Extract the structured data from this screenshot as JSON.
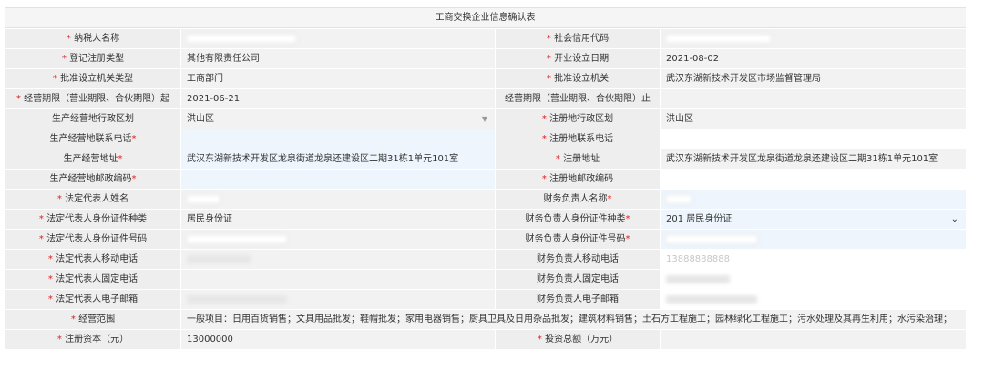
{
  "form_title": "工商交换企业信息确认表",
  "rows": [
    {
      "l1": "纳税人名称",
      "l1_req": "* ",
      "v1": "",
      "l2": "社会信用代码",
      "l2_req": "* ",
      "v2": ""
    },
    {
      "l1": "登记注册类型",
      "l1_req": "* ",
      "v1": "其他有限责任公司",
      "l2": "开业设立日期",
      "l2_req": "* ",
      "v2": "2021-08-02"
    },
    {
      "l1": "批准设立机关类型",
      "l1_req": "* ",
      "v1": "工商部门",
      "l2": "批准设立机关",
      "l2_req": "* ",
      "v2": "武汉东湖新技术开发区市场监督管理局"
    },
    {
      "l1": "经营期限（营业期限、合伙期限）起",
      "l1_req": "* ",
      "v1": "2021-06-21",
      "l2": "经营期限（营业期限、合伙期限）止",
      "l2_req": "",
      "v2": ""
    },
    {
      "l1": "生产经营地行政区划",
      "l1_req": "",
      "v1": "洪山区",
      "l2": "注册地行政区划",
      "l2_req": "* ",
      "v2": "洪山区"
    },
    {
      "l1": "生产经营地联系电话",
      "l1_suf": "*",
      "v1": "",
      "l2": "注册地联系电话",
      "l2_req": "* ",
      "v2": ""
    },
    {
      "l1": "生产经营地址",
      "l1_suf": "*",
      "v1": "武汉东湖新技术开发区龙泉街道龙泉还建设区二期31栋1单元101室",
      "l2": "注册地址",
      "l2_req": "* ",
      "v2": "武汉东湖新技术开发区龙泉街道龙泉还建设区二期31栋1单元101室"
    },
    {
      "l1": "生产经营地邮政编码",
      "l1_suf": "*",
      "v1": "",
      "l2": "注册地邮政编码",
      "l2_req": "* ",
      "v2": ""
    },
    {
      "l1": "法定代表人姓名",
      "l1_req": "* ",
      "v1": "",
      "l2": "财务负责人名称",
      "l2_suf": "*",
      "v2": ""
    },
    {
      "l1": "法定代表人身份证件种类",
      "l1_req": "* ",
      "v1": "居民身份证",
      "l2": "财务负责人身份证件种类",
      "l2_suf": "*",
      "v2": "201 居民身份证"
    },
    {
      "l1": "法定代表人身份证件号码",
      "l1_req": "* ",
      "v1": "",
      "l2": "财务负责人身份证件号码",
      "l2_suf": "*",
      "v2": ""
    },
    {
      "l1": "法定代表人移动电话",
      "l1_req": "* ",
      "v1": "",
      "l2": "财务负责人移动电话",
      "l2_req": "",
      "v2": "13888888888"
    },
    {
      "l1": "法定代表人固定电话",
      "l1_req": "* ",
      "v1": "",
      "l2": "财务负责人固定电话",
      "l2_req": "",
      "v2": ""
    },
    {
      "l1": "法定代表人电子邮箱",
      "l1_req": "* ",
      "v1": "",
      "l2": "财务负责人电子邮箱",
      "l2_req": "",
      "v2": ""
    },
    {
      "l1": "经营范围",
      "l1_req": "* ",
      "v_full": "一般项目：日用百货销售；文具用品批发；鞋帽批发；家用电器销售；厨具卫具及日用杂品批发；建筑材料销售；土石方工程施工；园林绿化工程施工；污水处理及其再生利用；水污染治理；"
    },
    {
      "l1": "注册资本（元）",
      "l1_req": "* ",
      "v1": "13000000",
      "l2": "投资总额（万元）",
      "l2_req": "* ",
      "v2": ""
    }
  ]
}
